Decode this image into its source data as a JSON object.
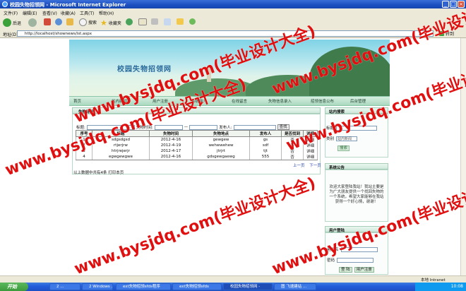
{
  "browser": {
    "title": "校园失物招领网 - Microsoft Internet Explorer",
    "menu": [
      "文件(F)",
      "编辑(E)",
      "查看(V)",
      "收藏(A)",
      "工具(T)",
      "帮助(H)"
    ],
    "toolbar": {
      "back": "后退",
      "search": "搜索",
      "favorites": "收藏夹"
    },
    "address_label": "地址(D)",
    "address": "http://localhost/shownews/ist.aspx",
    "go": "转到",
    "status_right": "本地 Intranet"
  },
  "site": {
    "name": "校园失物招领网",
    "nav": [
      "首页",
      "站内新闻",
      "用户注册",
      "系统简介",
      "在线留言",
      "失物信息录入",
      "招领信息公布",
      "后台管理"
    ]
  },
  "main": {
    "panel_title": "失物详细",
    "search": {
      "title_label": "标题:",
      "time_label": "失物时间:",
      "dash": "—",
      "place_label": "发布人:",
      "button": "查找"
    },
    "columns": [
      "序号",
      "标题",
      "失物时间",
      "失物地点",
      "发布人",
      "是否找到",
      "详细"
    ],
    "rows": [
      [
        "1",
        "sdgsdgsd",
        "2012-4-16",
        "gewgew",
        "gs",
        "否",
        "详细"
      ],
      [
        "2",
        "rtjerjrw",
        "2012-4-19",
        "wehwwehew",
        "sdf",
        "否",
        "详细"
      ],
      [
        "3",
        "htrjrejerjr",
        "2012-4-17",
        "jtrjrt",
        "tjt",
        "否",
        "详细"
      ],
      [
        "4",
        "egwgewgwe",
        "2012-4-16",
        "gdsgewgaewg",
        "555",
        "否",
        "详细"
      ]
    ],
    "pager": {
      "prev": "上一页",
      "next": "下一页"
    },
    "footer_note": "以上数据中共有4条 打印本页"
  },
  "sidebar": {
    "search_title": "站内搜索",
    "search_title_label": "标题",
    "search_category_label": "类别",
    "search_category_value": "站内新闻",
    "search_button": "搜索",
    "notice_title": "系统公告",
    "notice_text": "欢迎大家登陆我站！我站主要是为广大朋友提供一个找回失物的一个系统，希望大家能够在我站获得一个好心情，谢谢！",
    "login_title": "用户登陆",
    "username_label": "用户名",
    "password_label": "密码",
    "login_button": "登 陆",
    "register_button": "用户注册"
  },
  "watermark": "www.bysjdq.com(毕业设计大全)",
  "taskbar": {
    "start": "开始",
    "tasks": [
      "2 ...",
      "2 Windows ...",
      "ext失物招领sfds程序",
      "ext失物招领sfds",
      "校园失物招领网 -",
      "图 飞速建站 ..."
    ],
    "clock": "10:08"
  }
}
